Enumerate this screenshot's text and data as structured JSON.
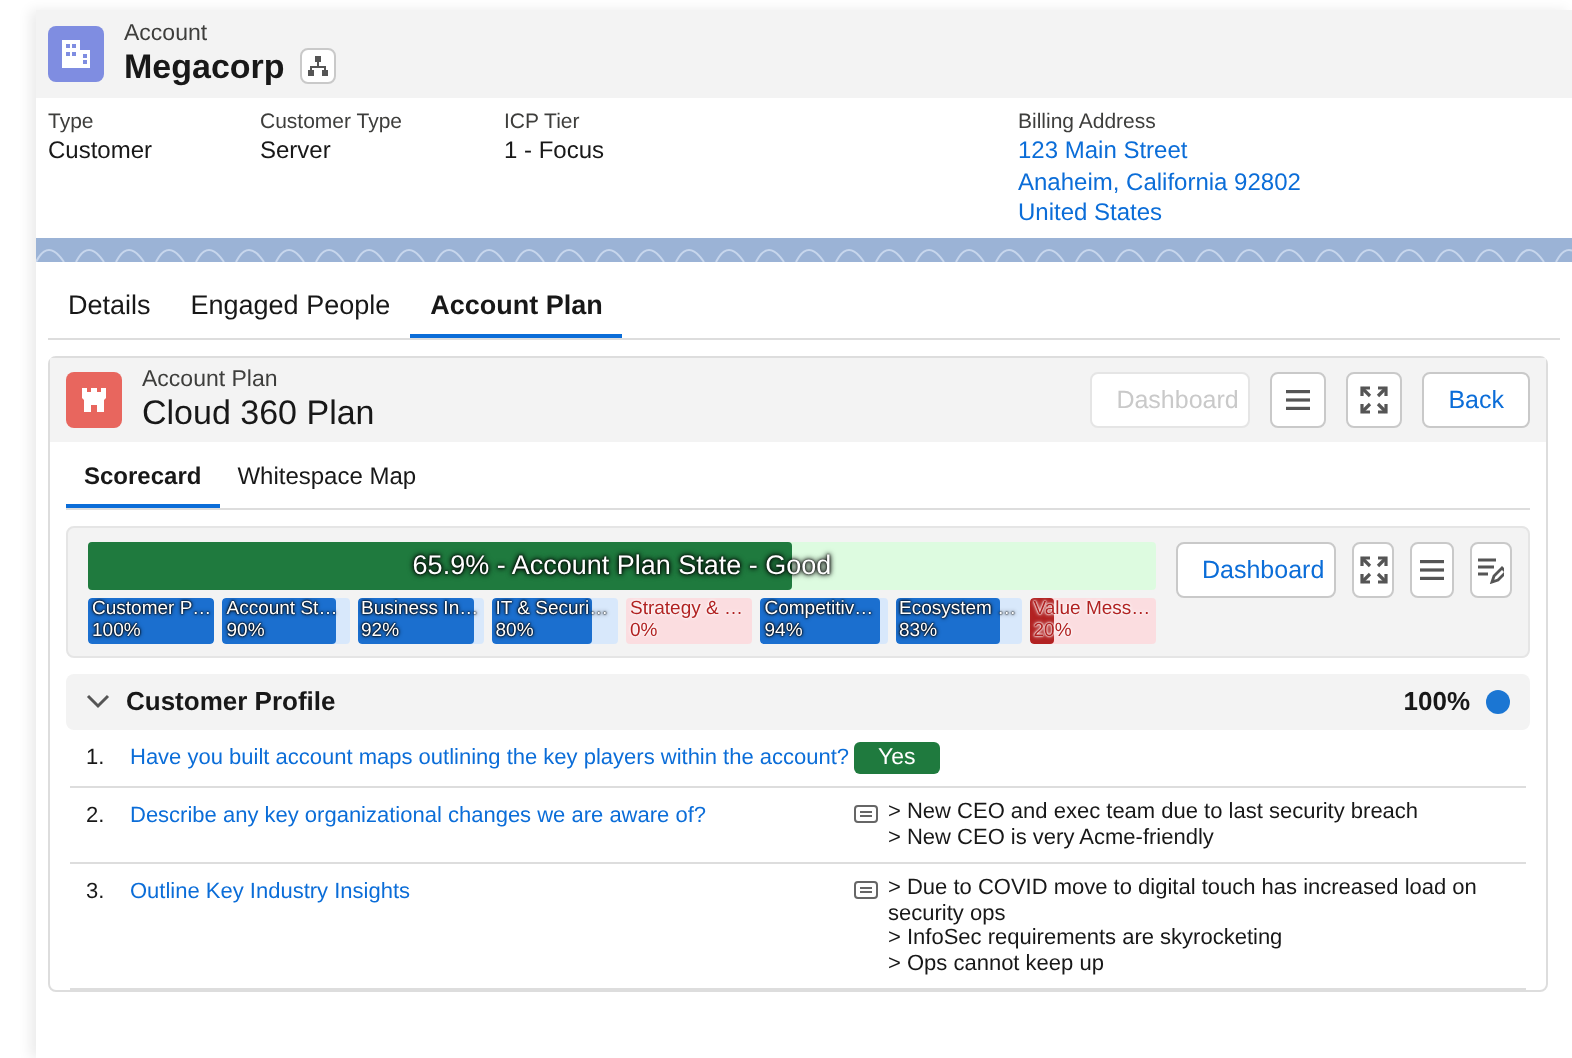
{
  "record": {
    "object": "Account",
    "name": "Megacorp"
  },
  "fields": [
    {
      "label": "Type",
      "lines": [
        "Customer"
      ],
      "kind": "text"
    },
    {
      "label": "Customer Type",
      "lines": [
        "Server"
      ],
      "kind": "text"
    },
    {
      "label": "ICP Tier",
      "lines": [
        "1 - Focus"
      ],
      "kind": "text"
    },
    {
      "label": "Billing Address",
      "lines": [
        "123 Main Street",
        "Anaheim, California 92802",
        "United States"
      ],
      "kind": "link"
    }
  ],
  "tabs": [
    {
      "label": "Details",
      "selected": false
    },
    {
      "label": "Engaged People",
      "selected": false
    },
    {
      "label": "Account Plan",
      "selected": true
    }
  ],
  "plan": {
    "object": "Account Plan",
    "name": "Cloud 360 Plan",
    "buttons": [
      {
        "label": "Dashboard",
        "disabled": true
      },
      {
        "label": "Back",
        "disabled": false
      }
    ],
    "subtabs": [
      {
        "label": "Scorecard",
        "selected": true
      },
      {
        "label": "Whitespace Map",
        "selected": false
      }
    ],
    "state": {
      "text": "65.9% - Account Plan State - Good",
      "level": 0.659
    },
    "dashboard_button": "Dashboard",
    "segments": [
      {
        "label": "Customer P…",
        "value": "100%",
        "level": 1.0,
        "color": "#1b6fcf"
      },
      {
        "label": "Account St…",
        "value": "90%",
        "level": 0.9,
        "color": "#1b6fcf"
      },
      {
        "label": "Business In…",
        "value": "92%",
        "level": 0.92,
        "color": "#1b6fcf"
      },
      {
        "label": "IT & Securi…",
        "value": "80%",
        "level": 0.8,
        "color": "#1b6fcf"
      },
      {
        "label": "Strategy & …",
        "value": "0%",
        "level": 0.0,
        "color": "#b22222"
      },
      {
        "label": "Competitiv…",
        "value": "94%",
        "level": 0.94,
        "color": "#1b6fcf"
      },
      {
        "label": "Ecosystem …",
        "value": "83%",
        "level": 0.83,
        "color": "#1b6fcf"
      },
      {
        "label": "Value Mess…",
        "value": "20%",
        "level": 0.2,
        "color": "#b22222"
      }
    ],
    "section": {
      "title": "Customer Profile",
      "expanded": true,
      "score": "100%",
      "color": "#1b76d3",
      "questions": [
        {
          "number": "1.",
          "text": "Have you built account maps outlining the key players within the account?",
          "kind": "badge",
          "answer": [
            "Yes"
          ]
        },
        {
          "number": "2.",
          "text": "Describe any key organizational changes we are aware of?",
          "kind": "note",
          "answer": [
            "> New CEO and exec team due to last security breach",
            "> New CEO is very Acme-friendly"
          ]
        },
        {
          "number": "3.",
          "text": "Outline Key Industry Insights",
          "kind": "note",
          "answer": [
            "> Due to COVID move to digital touch has increased load on security ops",
            "> InfoSec requirements are skyrocketing",
            "> Ops cannot keep up"
          ]
        }
      ]
    }
  }
}
